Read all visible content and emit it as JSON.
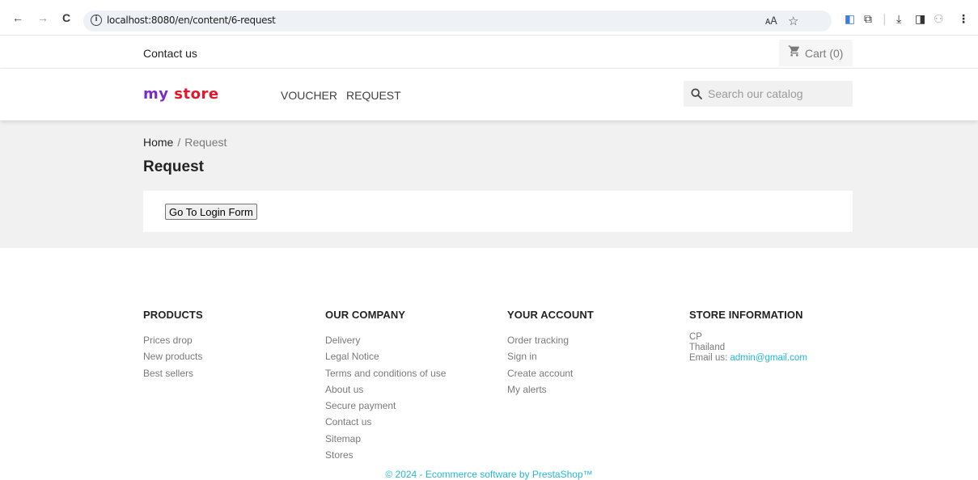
{
  "browser": {
    "url": "localhost:8080/en/content/6-request",
    "back_icon": "←",
    "forward_icon": "→",
    "reload_icon": "C",
    "info_icon": "i"
  },
  "top_nav": {
    "contact_label": "Contact us",
    "cart_label": "Cart (0)"
  },
  "header": {
    "logo_part1": "my ",
    "logo_part2": "store",
    "menu": [
      "VOUCHER",
      "REQUEST"
    ],
    "search_placeholder": "Search our catalog"
  },
  "breadcrumb": {
    "home": "Home",
    "separator": "/",
    "current": "Request"
  },
  "page": {
    "title": "Request",
    "button_label": "Go To Login Form"
  },
  "footer": {
    "products": {
      "title": "PRODUCTS",
      "links": [
        "Prices drop",
        "New products",
        "Best sellers"
      ]
    },
    "company": {
      "title": "OUR COMPANY",
      "links": [
        "Delivery",
        "Legal Notice",
        "Terms and conditions of use",
        "About us",
        "Secure payment",
        "Contact us",
        "Sitemap",
        "Stores"
      ]
    },
    "account": {
      "title": "YOUR ACCOUNT",
      "links": [
        "Order tracking",
        "Sign in",
        "Create account",
        "My alerts"
      ]
    },
    "store": {
      "title": "STORE INFORMATION",
      "name": "CP",
      "country": "Thailand",
      "email_label": "Email us: ",
      "email": "admin@gmail.com"
    },
    "copyright": "© 2024 - Ecommerce software by PrestaShop™"
  },
  "colors": {
    "accent": "#24b9d7",
    "logo_purple": "#7a2cc8",
    "logo_red": "#e3162b",
    "wrapper_bg": "#f1f1f1"
  }
}
